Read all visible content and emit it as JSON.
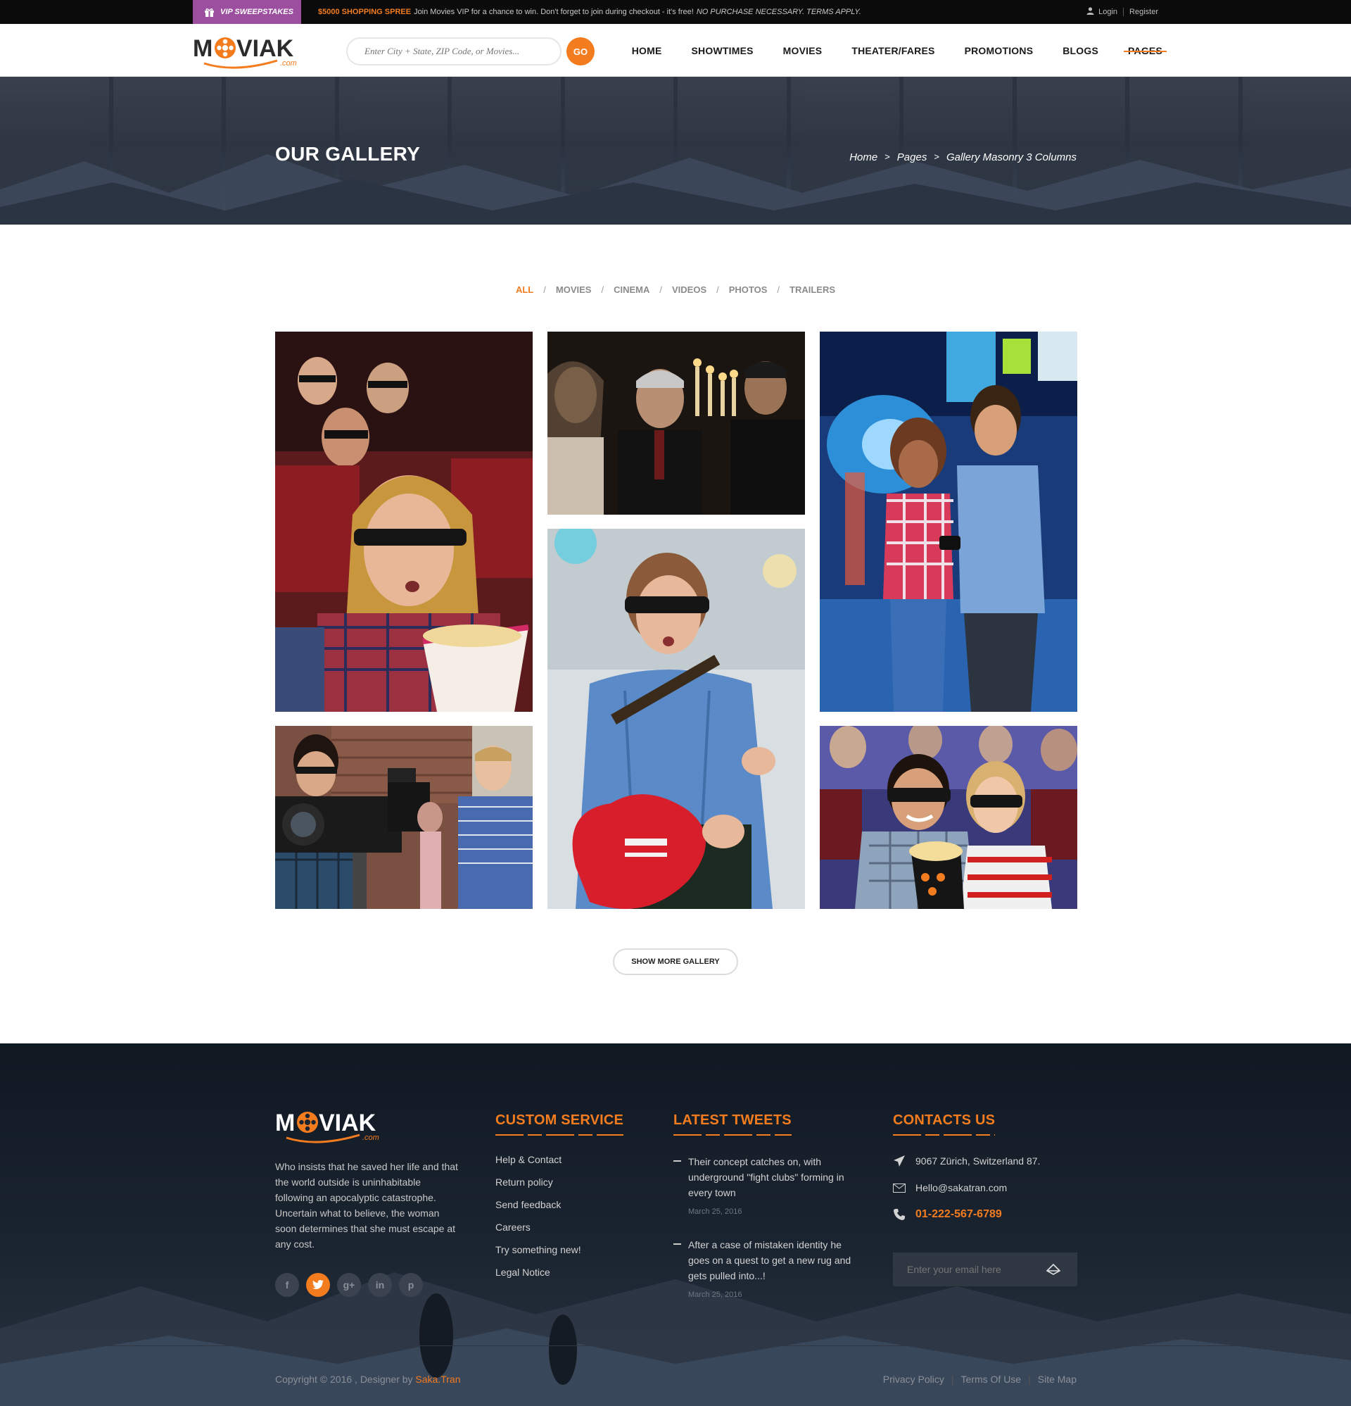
{
  "topbar": {
    "vip_label": "VIP SWEEPSTAKES",
    "promo_highlight": "$5000 SHOPPING SPREE",
    "promo_text": "Join Movies VIP for a chance to win. Don't forget to join during checkout - it's free!",
    "promo_note": "NO PURCHASE NECESSARY. TERMS APPLY.",
    "login": "Login",
    "register": "Register"
  },
  "header": {
    "logo_text": "MOVIAK",
    "logo_sub": ".com",
    "search_placeholder": "Enter City + State, ZIP Code, or Movies...",
    "go_label": "GO",
    "nav": [
      "HOME",
      "SHOWTIMES",
      "MOVIES",
      "THEATER/FARES",
      "PROMOTIONS",
      "BLOGS",
      "PAGES"
    ],
    "active_nav": "PAGES"
  },
  "hero": {
    "title": "OUR GALLERY",
    "breadcrumb": [
      "Home",
      "Pages",
      "Gallery Masonry 3 Columns"
    ],
    "separator": ">"
  },
  "filters": {
    "items": [
      "ALL",
      "MOVIES",
      "CINEMA",
      "VIDEOS",
      "PHOTOS",
      "TRAILERS"
    ],
    "active": "ALL",
    "separator": "/"
  },
  "gallery": {
    "items": [
      {
        "subject": "woman-3d-glasses-popcorn"
      },
      {
        "subject": "movie-scene-candles"
      },
      {
        "subject": "couple-arcade-phones"
      },
      {
        "subject": "guitarist-sunglasses"
      },
      {
        "subject": "film-crew-camera"
      },
      {
        "subject": "couple-3d-glasses-popcorn"
      }
    ],
    "show_more": "SHOW MORE GALLERY"
  },
  "footer": {
    "logo_text": "MOVIAK",
    "logo_sub": ".com",
    "description": "Who insists that he saved her life and that the world outside is uninhabitable following an apocalyptic catastrophe. Uncertain what to believe, the woman soon determines that she must escape at any cost.",
    "socials": [
      "f",
      "t",
      "g+",
      "in",
      "p"
    ],
    "custom_service": {
      "title": "CUSTOM SERVICE",
      "links": [
        "Help & Contact",
        "Return policy",
        "Send feedback",
        "Careers",
        "Try something new!",
        "Legal Notice"
      ]
    },
    "tweets": {
      "title": "LATEST TWEETS",
      "items": [
        {
          "text": "Their concept catches on, with underground \"fight clubs\" forming in every town",
          "date": "March 25, 2016"
        },
        {
          "text": "After a case of mistaken identity he goes on a quest to get a new rug and gets pulled into...!",
          "date": "March 25, 2016"
        }
      ]
    },
    "contacts": {
      "title": "CONTACTS US",
      "address": "9067 Zürich, Switzerland 87.",
      "email": "Hello@sakatran.com",
      "phone": "01-222-567-6789",
      "email_placeholder": "Enter your email here"
    },
    "copyright": "Copyright © 2016 , Designer by",
    "designer": "Saka.Tran",
    "legal": [
      "Privacy Policy",
      "Terms Of Use",
      "Site Map"
    ]
  },
  "colors": {
    "accent": "#f37c1f",
    "vip": "#9b4f9e",
    "topbar": "#0b0b0b",
    "footer": "#1a2430"
  }
}
